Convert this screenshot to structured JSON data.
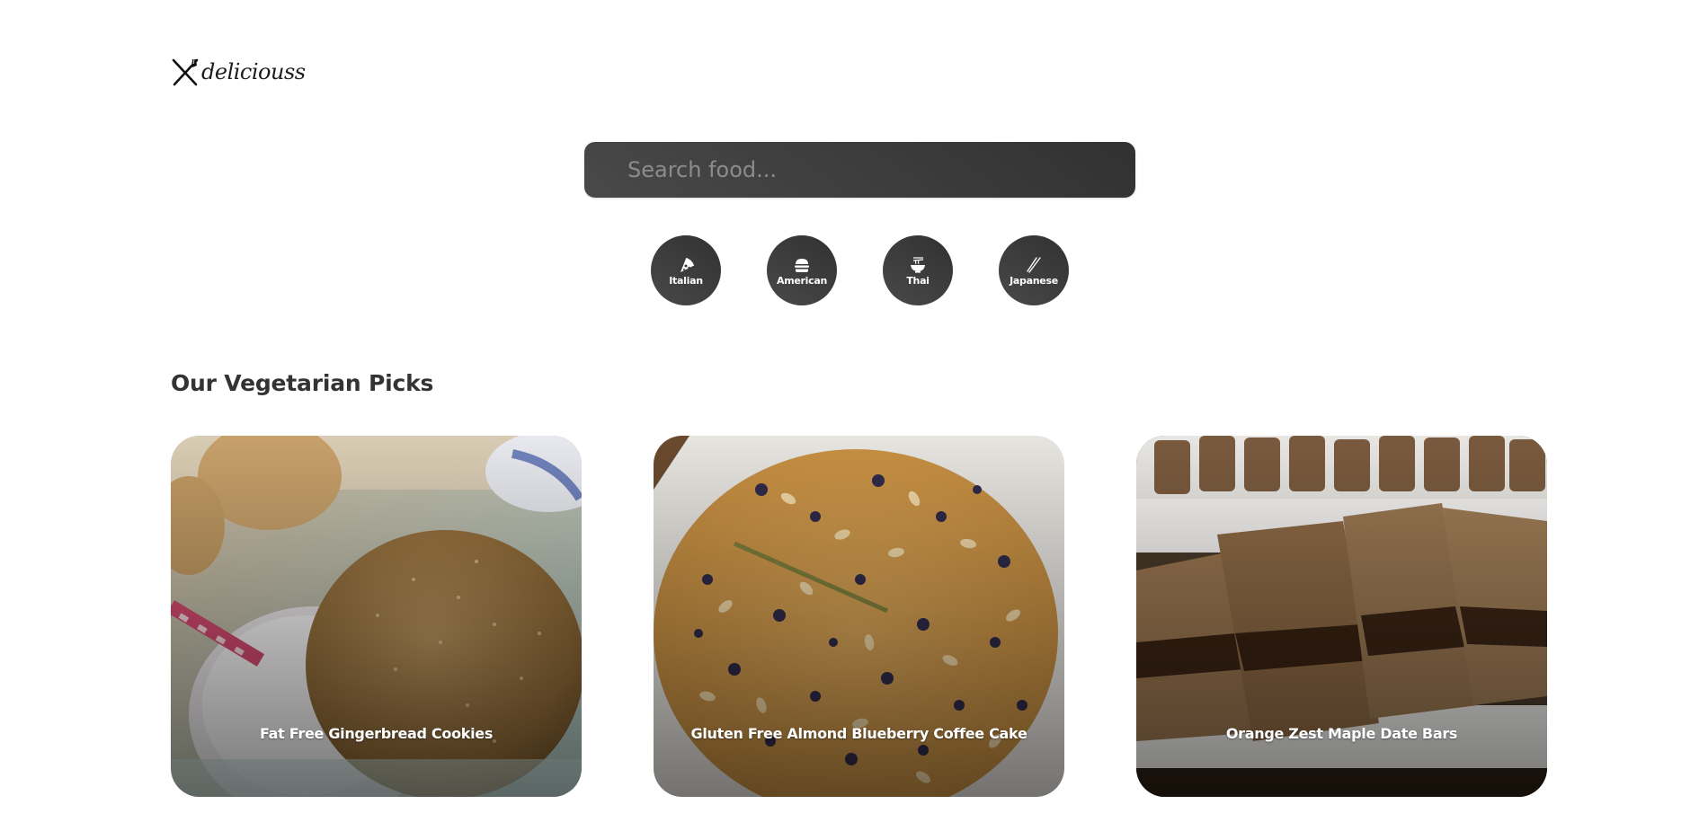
{
  "brand": {
    "name": "deliciouss",
    "icon": "fork-knife-icon"
  },
  "search": {
    "placeholder": "Search food...",
    "value": ""
  },
  "categories": [
    {
      "label": "Italian",
      "icon": "pizza-icon"
    },
    {
      "label": "American",
      "icon": "burger-icon"
    },
    {
      "label": "Thai",
      "icon": "noodle-bowl-icon"
    },
    {
      "label": "Japanese",
      "icon": "chopsticks-icon"
    }
  ],
  "section": {
    "title": "Our Vegetarian Picks"
  },
  "recipes": [
    {
      "title": "Fat Free Gingerbread Cookies"
    },
    {
      "title": "Gluten Free Almond Blueberry Coffee Cake"
    },
    {
      "title": "Orange Zest Maple Date Bars"
    }
  ],
  "colors": {
    "button_dark": "#313131",
    "button_light": "#494949",
    "heading": "#333333",
    "placeholder": "#8c8c8c"
  }
}
